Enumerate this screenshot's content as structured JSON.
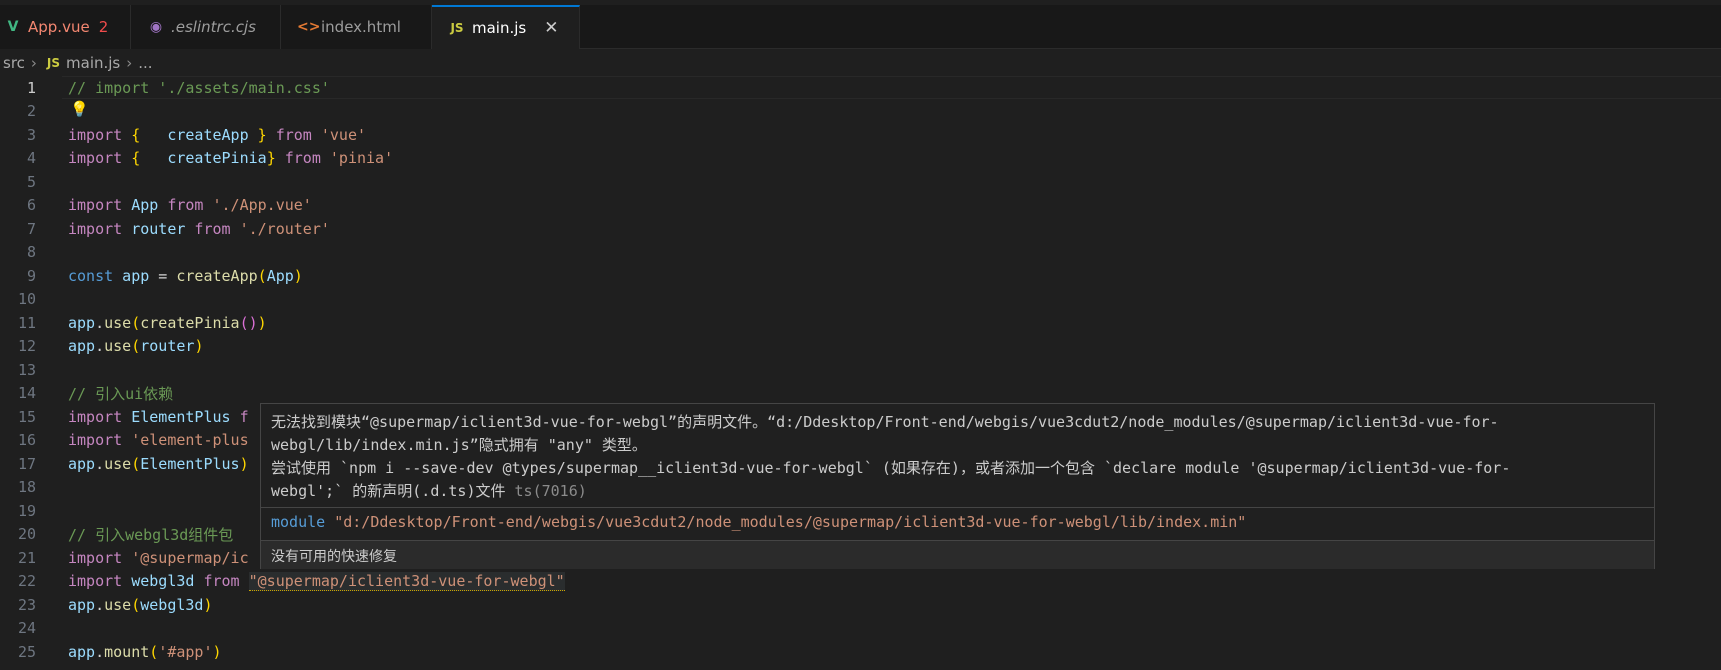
{
  "tabs": [
    {
      "label": "App.vue",
      "icon": "vue-icon",
      "badge": "2"
    },
    {
      "label": ".eslintrc.cjs",
      "icon": "eslint-icon"
    },
    {
      "label": "index.html",
      "icon": "html-icon"
    },
    {
      "label": "main.js",
      "icon": "js-icon",
      "close": "✕"
    }
  ],
  "breadcrumb": {
    "folder": "src",
    "file": "main.js",
    "tail": "..."
  },
  "lines": {
    "n1": "1",
    "n2": "2",
    "n3": "3",
    "n4": "4",
    "n5": "5",
    "n6": "6",
    "n7": "7",
    "n8": "8",
    "n9": "9",
    "n10": "10",
    "n11": "11",
    "n12": "12",
    "n13": "13",
    "n14": "14",
    "n15": "15",
    "n16": "16",
    "n17": "17",
    "n18": "18",
    "n19": "19",
    "n20": "20",
    "n21": "21",
    "n22": "22",
    "n23": "23",
    "n24": "24",
    "n25": "25",
    "l1": "// import './assets/main.css'",
    "l3_import": "import",
    "l3_open": " {",
    "l3_name": "   createApp ",
    "l3_close": "}",
    "l3_from": " from ",
    "l3_str": "'vue'",
    "l4_import": "import",
    "l4_open": " {",
    "l4_name": "   createPinia",
    "l4_close": "}",
    "l4_from": " from ",
    "l4_str": "'pinia'",
    "l6_import": "import",
    "l6_name": " App",
    "l6_from": " from ",
    "l6_str": "'./App.vue'",
    "l7_import": "import",
    "l7_name": " router",
    "l7_from": " from ",
    "l7_str": "'./router'",
    "l9_const": "const",
    "l9_var": " app",
    "l9_eq": " = ",
    "l9_fn": "createApp",
    "l9_open": "(",
    "l9_arg": "App",
    "l9_close": ")",
    "l11_var": "app",
    "l11_dot": ".",
    "l11_fn": "use",
    "l11_open": "(",
    "l11_fn2": "createPinia",
    "l11_inner": "()",
    "l11_close": ")",
    "l12_var": "app",
    "l12_dot": ".",
    "l12_fn": "use",
    "l12_open": "(",
    "l12_arg": "router",
    "l12_close": ")",
    "l14": "// 引入ui依赖",
    "l15_import": "import",
    "l15_name": " ElementPlus",
    "l15_rest": " f",
    "l16_import": "import",
    "l16_str": " 'element-plus",
    "l17_var": "app",
    "l17_dot": ".",
    "l17_fn": "use",
    "l17_open": "(",
    "l17_arg": "ElementPlus",
    "l17_close": ")",
    "l20": "// 引入webgl3d组件包",
    "l21_import": "import",
    "l21_str": " '@supermap/ic",
    "l22_import": "import",
    "l22_name": " webgl3d",
    "l22_from": " from ",
    "l22_str": "\"@supermap/iclient3d-vue-for-webgl\"",
    "l23_var": "app",
    "l23_dot": ".",
    "l23_fn": "use",
    "l23_open": "(",
    "l23_arg": "webgl3d",
    "l23_close": ")",
    "l25_var": "app",
    "l25_dot": ".",
    "l25_fn": "mount",
    "l25_open": "(",
    "l25_str": "'#app'",
    "l25_close": ")"
  },
  "hover": {
    "line1": "无法找到模块“@supermap/iclient3d-vue-for-webgl”的声明文件。“d:/Ddesktop/Front-end/webgis/vue3cdut2/node_modules/@supermap/iclient3d-vue-for-",
    "line2": "webgl/lib/index.min.js”隐式拥有 \"any\" 类型。",
    "line3": "  尝试使用 `npm i --save-dev @types/supermap__iclient3d-vue-for-webgl` (如果存在)，或者添加一个包含 `declare module '@supermap/iclient3d-vue-for-",
    "line4": "webgl';` 的新声明(.d.ts)文件",
    "code": "ts(7016)",
    "module_kw": "module",
    "module_path": "\"d:/Ddesktop/Front-end/webgis/vue3cdut2/node_modules/@supermap/iclient3d-vue-for-webgl/lib/index.min\"",
    "no_fix": "没有可用的快速修复"
  },
  "colors": {
    "accent": "#0078d4",
    "error": "#f14c4c",
    "warning": "#cca700"
  }
}
